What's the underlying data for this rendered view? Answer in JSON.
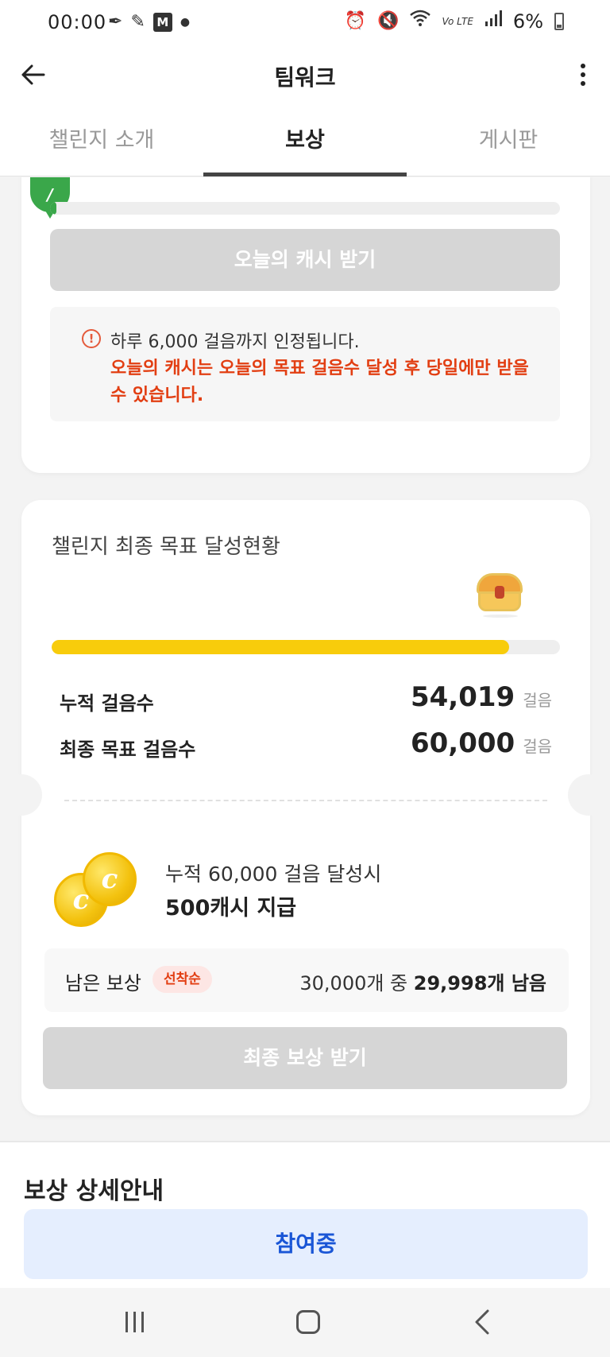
{
  "status_bar": {
    "time": "00:00",
    "battery": "6%",
    "left_icons": [
      "feather-icon",
      "pen-icon",
      "m-app-icon",
      "dot-icon"
    ],
    "m_icon_label": "M",
    "right_icons": [
      "alarm-icon",
      "mute-icon",
      "wifi-icon",
      "volte-icon",
      "signal-icon",
      "battery-icon"
    ],
    "volte_label": "Vo LTE"
  },
  "header": {
    "title": "팀워크"
  },
  "tabs": [
    {
      "label": "챌린지 소개",
      "active": false
    },
    {
      "label": "보상",
      "active": true
    },
    {
      "label": "게시판",
      "active": false
    }
  ],
  "daily": {
    "progress": 0.005,
    "button_label": "오늘의 캐시 받기",
    "notice_line1": "하루 6,000 걸음까지 인정됩니다.",
    "notice_line2": "오늘의 캐시는 오늘의 목표 걸음수 달성 후 당일에만 받을 수 있습니다."
  },
  "final_goal": {
    "title": "챌린지 최종 목표 달성현황",
    "progress": 0.9,
    "accumulated_label": "누적 걸음수",
    "accumulated_value": "54,019",
    "target_label": "최종 목표 걸음수",
    "target_value": "60,000",
    "unit": "걸음",
    "reward_line1": "누적 60,000 걸음 달성시",
    "reward_line2": "500캐시 지급",
    "remain_label": "남은 보상",
    "remain_badge": "선착순",
    "remain_prefix": "30,000개 중 ",
    "remain_count": "29,998개 남음",
    "button_label": "최종 보상 받기"
  },
  "detail": {
    "title": "보상 상세안내"
  },
  "join_button": "참여중",
  "colors": {
    "accent_yellow": "#f8cc0b",
    "marker_green": "#3aa74a",
    "alert_red": "#e23e12",
    "join_blue": "#1a56d6"
  }
}
